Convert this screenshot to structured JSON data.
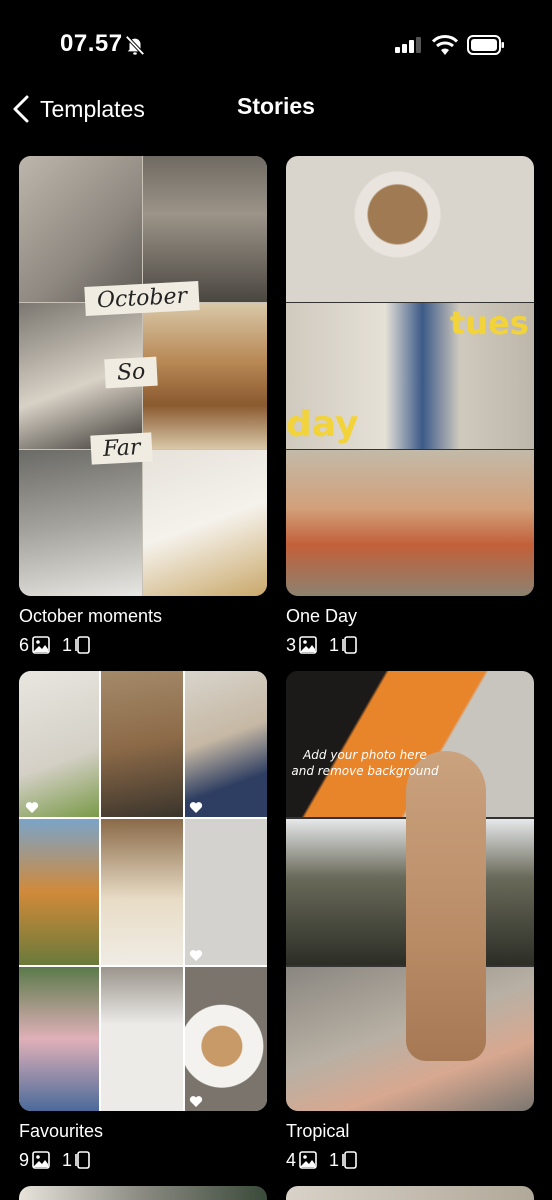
{
  "status": {
    "time": "07.57"
  },
  "nav": {
    "back_label": "Templates",
    "title": "Stories"
  },
  "cards": [
    {
      "name": "October moments",
      "photos": "6",
      "pages": "1"
    },
    {
      "name": "One Day",
      "photos": "3",
      "pages": "1"
    },
    {
      "name": "Favourites",
      "photos": "9",
      "pages": "1"
    },
    {
      "name": "Tropical",
      "photos": "4",
      "pages": "1"
    }
  ],
  "october": {
    "w1": "October",
    "w2": "So",
    "w3": "Far"
  },
  "oneday": {
    "tues": "tues",
    "day": "day"
  },
  "tropical": {
    "hint": "Add your photo here and remove background"
  },
  "icons": [
    "bell-slash-icon",
    "signal-icon",
    "wifi-icon",
    "battery-icon",
    "back-chevron-icon",
    "photo-icon",
    "page-icon",
    "heart-icon"
  ]
}
